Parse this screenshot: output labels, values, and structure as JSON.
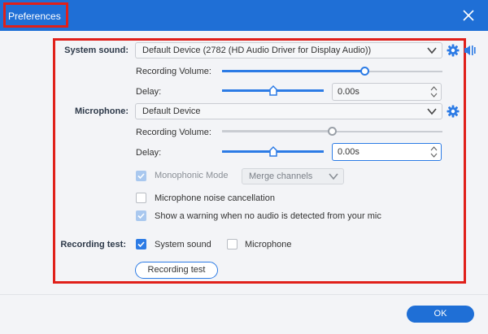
{
  "window": {
    "title": "Preferences"
  },
  "system_sound": {
    "label": "System sound:",
    "device": "Default Device (2782 (HD Audio Driver for Display Audio))",
    "recording_volume_label": "Recording Volume:",
    "recording_volume_fraction": 0.65,
    "delay_label": "Delay:",
    "delay_value": "0.00s",
    "delay_slider_fraction": 0.5
  },
  "microphone": {
    "label": "Microphone:",
    "device": "Default Device",
    "recording_volume_label": "Recording Volume:",
    "recording_volume_fraction": 0.5,
    "delay_label": "Delay:",
    "delay_value": "0.00s",
    "delay_slider_fraction": 0.5
  },
  "options": {
    "monophonic_mode": {
      "label": "Monophonic Mode",
      "checked": true,
      "disabled": true
    },
    "channel_mode": "Merge channels",
    "noise_cancellation": {
      "label": "Microphone noise cancellation",
      "checked": false
    },
    "no_audio_warning": {
      "label": "Show a warning when no audio is detected from your mic",
      "checked": true,
      "disabled": true
    }
  },
  "recording_test": {
    "label": "Recording test:",
    "system_sound_label": "System sound",
    "system_sound_checked": true,
    "microphone_label": "Microphone",
    "microphone_checked": false,
    "button_label": "Recording test"
  },
  "footer": {
    "ok_label": "OK"
  },
  "colors": {
    "accent": "#2c7be5",
    "titlebar": "#1f6fd6",
    "highlight": "#e0201a"
  },
  "icons": [
    "close-icon",
    "gear-icon",
    "speaker-bars-icon",
    "chevron-down-icon",
    "spin-arrows-icon",
    "checkmark-icon"
  ]
}
